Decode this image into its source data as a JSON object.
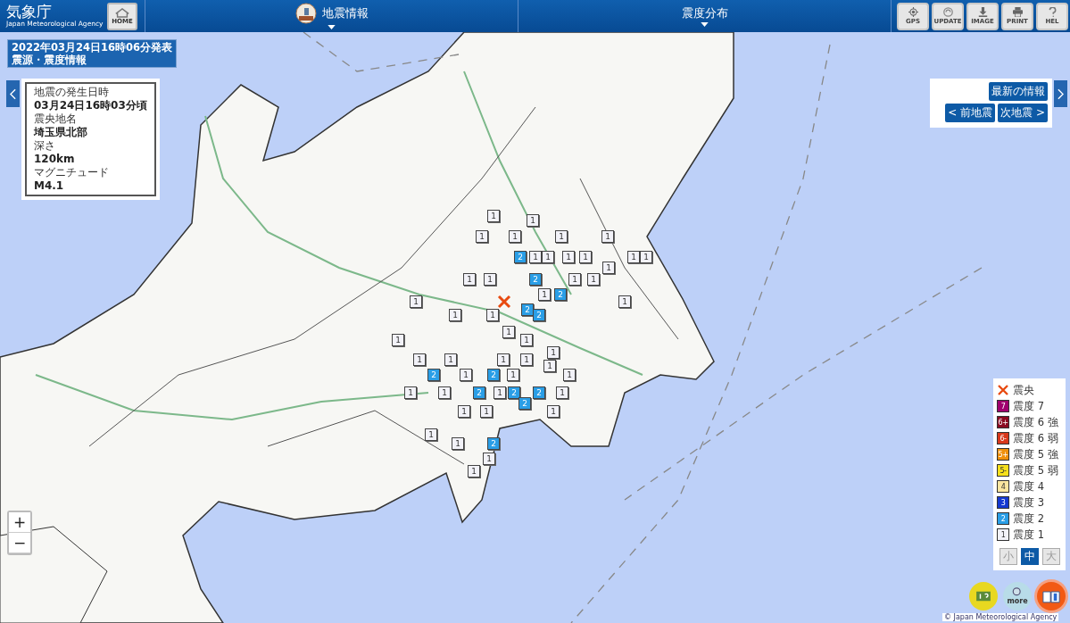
{
  "header": {
    "logo_text": "気象庁",
    "logo_subtitle": "Japan Meteorological Agency",
    "home_button": "HOME",
    "menus": [
      {
        "label": "地震情報",
        "icon": true
      },
      {
        "label": "震度分布",
        "icon": false
      }
    ],
    "tools": [
      {
        "kind": "gps",
        "label": "GPS"
      },
      {
        "kind": "update",
        "label": "UPDATE"
      },
      {
        "label": "IMAGE"
      },
      {
        "kind": "print",
        "label": "PRINT"
      },
      {
        "kind": "help",
        "label": "HEL"
      }
    ]
  },
  "announcement": {
    "line1": "2022年03月24日16時06分発表",
    "line2": "震源・震度情報"
  },
  "quake_info": [
    {
      "label": "地震の発生日時",
      "value": "03月24日16時03分頃"
    },
    {
      "label": "震央地名",
      "value": "埼玉県北部"
    },
    {
      "label": "深さ",
      "value": "120km"
    },
    {
      "label": "マグニチュード",
      "value": "M4.1"
    }
  ],
  "nav": {
    "latest": "最新の情報",
    "prev": "< 前地震",
    "next": "次地震 >"
  },
  "legend": {
    "items": [
      {
        "kind": "epicenter",
        "label": "震央"
      },
      {
        "kind": "scale",
        "badge": "7",
        "label": "震度 7",
        "color": "#a0006e"
      },
      {
        "kind": "scale",
        "badge": "6+",
        "label": "震度 6 強",
        "color": "#8a0a20"
      },
      {
        "kind": "scale",
        "badge": "6-",
        "label": "震度 6 弱",
        "color": "#d8381c"
      },
      {
        "kind": "scale",
        "badge": "5+",
        "label": "震度 5 強",
        "color": "#f0900c"
      },
      {
        "kind": "scale",
        "badge": "5-",
        "label": "震度 5 弱",
        "color": "#f6e01c"
      },
      {
        "kind": "scale",
        "badge": "4",
        "label": "震度 4",
        "color": "#fbe6a0"
      },
      {
        "kind": "scale",
        "badge": "3",
        "label": "震度 3",
        "color": "#1438d0"
      },
      {
        "kind": "scale",
        "badge": "2",
        "label": "震度 2",
        "color": "#2a9ee6"
      },
      {
        "kind": "scale",
        "badge": "1",
        "label": "震度 1",
        "color": "#f2f2f8"
      }
    ],
    "sizes": [
      {
        "label": "小",
        "selected": false
      },
      {
        "label": "中",
        "selected": true
      },
      {
        "label": "大",
        "selected": false
      }
    ]
  },
  "stations": [
    {
      "kind": "shindo1",
      "label": "1"
    },
    {
      "kind": "shindo1",
      "label": "1"
    },
    {
      "kind": "shindo1",
      "label": "1"
    },
    {
      "kind": "shindo1",
      "label": "1"
    },
    {
      "kind": "shindo1",
      "label": "1"
    },
    {
      "kind": "shindo1",
      "label": "1"
    },
    {
      "kind": "shindo2",
      "label": "2"
    },
    {
      "kind": "shindo1",
      "label": "1"
    },
    {
      "kind": "shindo1",
      "label": "1"
    },
    {
      "kind": "shindo1",
      "label": "1"
    },
    {
      "kind": "shindo1",
      "label": "1"
    },
    {
      "kind": "shindo1",
      "label": "1"
    },
    {
      "kind": "shindo1",
      "label": "1"
    },
    {
      "kind": "shindo1",
      "label": "1"
    },
    {
      "kind": "shindo1",
      "label": "1"
    },
    {
      "kind": "shindo1",
      "label": "1"
    },
    {
      "kind": "shindo2",
      "label": "2"
    },
    {
      "kind": "shindo1",
      "label": "1"
    },
    {
      "kind": "shindo1",
      "label": "1"
    },
    {
      "kind": "shindo1",
      "label": "1"
    },
    {
      "kind": "shindo2",
      "label": "2"
    },
    {
      "kind": "shindo1",
      "label": "1"
    },
    {
      "kind": "shindo1",
      "label": "1"
    },
    {
      "kind": "shindo2",
      "label": "2"
    },
    {
      "kind": "shindo1",
      "label": "1"
    },
    {
      "kind": "shindo1",
      "label": "1"
    },
    {
      "kind": "shindo2",
      "label": "2"
    },
    {
      "kind": "shindo1",
      "label": "1"
    },
    {
      "kind": "shindo1",
      "label": "1"
    },
    {
      "kind": "shindo1",
      "label": "1"
    },
    {
      "kind": "shindo1",
      "label": "1"
    },
    {
      "kind": "shindo1",
      "label": "1"
    },
    {
      "kind": "shindo1",
      "label": "1"
    },
    {
      "kind": "shindo1",
      "label": "1"
    },
    {
      "kind": "shindo1",
      "label": "1"
    },
    {
      "kind": "shindo1",
      "label": "1"
    },
    {
      "kind": "shindo2",
      "label": "2"
    },
    {
      "kind": "shindo1",
      "label": "1"
    },
    {
      "kind": "shindo2",
      "label": "2"
    },
    {
      "kind": "shindo1",
      "label": "1"
    },
    {
      "kind": "shindo1",
      "label": "1"
    },
    {
      "kind": "shindo1",
      "label": "1"
    },
    {
      "kind": "shindo1",
      "label": "1"
    },
    {
      "kind": "shindo2",
      "label": "2"
    },
    {
      "kind": "shindo1",
      "label": "1"
    },
    {
      "kind": "shindo2",
      "label": "2"
    },
    {
      "kind": "shindo2",
      "label": "2"
    },
    {
      "kind": "shindo1",
      "label": "1"
    },
    {
      "kind": "shindo2",
      "label": "2"
    },
    {
      "kind": "shindo1",
      "label": "1"
    },
    {
      "kind": "shindo1",
      "label": "1"
    },
    {
      "kind": "shindo1",
      "label": "1"
    },
    {
      "kind": "shindo1",
      "label": "1"
    },
    {
      "kind": "shindo1",
      "label": "1"
    },
    {
      "kind": "shindo2",
      "label": "2"
    },
    {
      "kind": "shindo1",
      "label": "1"
    },
    {
      "kind": "shindo1",
      "label": "1"
    }
  ],
  "zoom": {
    "in": "+",
    "out": "−"
  },
  "corner_buttons": [
    {
      "kind": "legend-help"
    },
    {
      "kind": "more",
      "label": "more"
    },
    {
      "kind": "info",
      "selected": true
    }
  ],
  "attribution": "© Japan Meteorological Agency"
}
